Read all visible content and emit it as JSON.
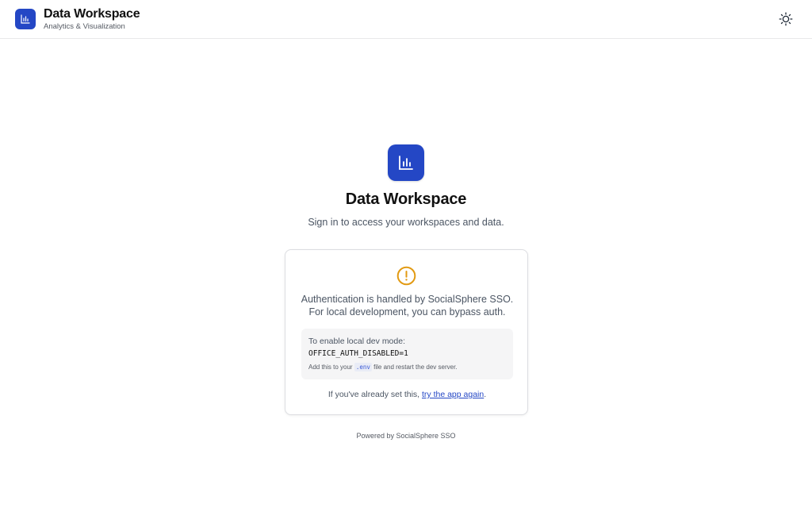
{
  "header": {
    "logo_icon": "bar-chart-icon",
    "title": "Data Workspace",
    "subtitle": "Analytics & Visualization",
    "theme_icon": "sun-icon"
  },
  "hero": {
    "logo_icon": "bar-chart-icon",
    "title": "Data Workspace",
    "subtitle": "Sign in to access your workspaces and data."
  },
  "card": {
    "icon": "warning-circle-icon",
    "message": "Authentication is handled by SocialSphere SSO. For local development, you can bypass auth.",
    "dev_box": {
      "heading": "To enable local dev mode:",
      "code": "OFFICE_AUTH_DISABLED=1",
      "note_before": "Add this to your",
      "env_file": ".env",
      "note_after": "file and restart the dev server."
    },
    "retry_prefix": "If you've already set this,",
    "retry_link": "try the app again",
    "retry_suffix": "."
  },
  "footer": {
    "text": "Powered by SocialSphere SSO"
  },
  "colors": {
    "brand": "#2447c5",
    "warning": "#e29a12",
    "link": "#2447c5"
  }
}
